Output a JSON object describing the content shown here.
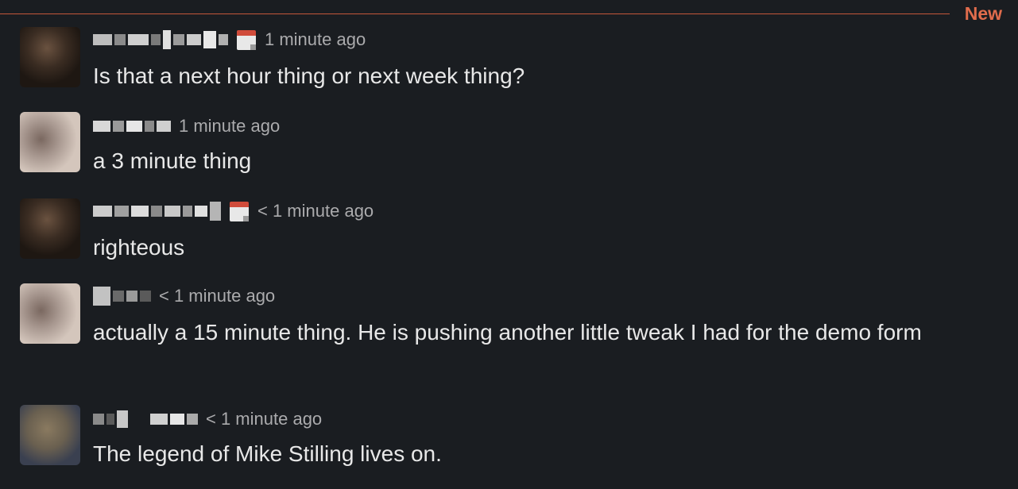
{
  "divider": {
    "new_label": "New"
  },
  "messages": [
    {
      "timestamp": "1 minute ago",
      "text": "Is that a next hour thing or next week thing?",
      "has_calendar_status": true
    },
    {
      "timestamp": "1 minute ago",
      "text": "a 3 minute thing",
      "has_calendar_status": false
    },
    {
      "timestamp": "< 1 minute ago",
      "text": "righteous",
      "has_calendar_status": true
    },
    {
      "timestamp": "< 1 minute ago",
      "text": "actually a 15 minute thing. He is pushing another little tweak I had for the demo form",
      "has_calendar_status": false
    },
    {
      "timestamp": "< 1 minute ago",
      "text": "The legend of Mike Stilling lives on.",
      "has_calendar_status": false
    }
  ],
  "icons": {
    "status": "calendar-icon"
  },
  "colors": {
    "background": "#1a1d21",
    "new_divider": "#c4573a",
    "new_label": "#e06c4c"
  }
}
